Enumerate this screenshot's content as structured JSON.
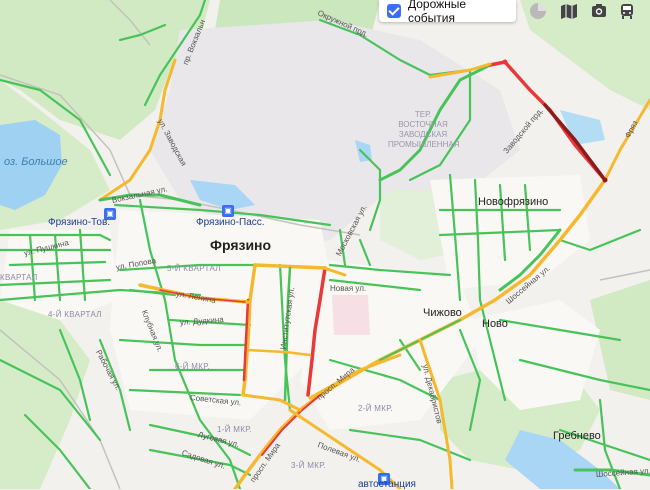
{
  "controls": {
    "traffic_events_label": "Дорожные события",
    "traffic_events_checked": true,
    "icons": [
      "traffic-level-icon",
      "map-layers-icon",
      "camera-icon",
      "transport-icon"
    ]
  },
  "map": {
    "city": "Фрязино",
    "places": {
      "novofryazino": "Новофрязино",
      "chizhovo": "Чижово",
      "novo": "Ново",
      "grebnevo": "Гребнево"
    },
    "lake": "оз. Большое",
    "stations": {
      "fryazino_tov": "Фрязино-Тов.",
      "fryazino_pass": "Фрязино-Пасс."
    },
    "bus_stop": "автостанция",
    "zone": [
      "ТЕР.",
      "ВОСТОЧНАЯ",
      "ЗАВОДСКАЯ",
      "ПРОМЫШЛЕННАЯ"
    ],
    "districts": {
      "q5": "5-Й КВАРТАЛ",
      "q4": "4-Й КВАРТАЛ",
      "kvartal": "КВАРТАЛ",
      "mkr6": "6-Й МКР.",
      "mkr1": "1-Й МКР.",
      "mkr2": "2-Й МКР.",
      "mkr3": "3-Й МКР."
    },
    "streets": {
      "okruzhnoy": "Окружной прд.",
      "vokzalnaya": "Вокзальная ул.",
      "pushkina": "ул. Пушкина",
      "popova": "ул. Попова",
      "lenina": "ул. Ленина",
      "dudkina": "ул. Дудкина",
      "klubnaya": "Клубная ул.",
      "rabochaya": "Рабочая ул.",
      "sovetskaya": "Советская ул.",
      "lugovaya": "Луговая ул.",
      "sadovaya": "Садовая ул.",
      "institutskaya": "Институтская ул.",
      "novaya": "Новая ул.",
      "moskovskaya": "Московская ул.",
      "mira_1": "просп. Мира",
      "mira_2": "просп. Мира",
      "polevaya": "Полевая ул.",
      "dekabristov": "ул. Декабристов",
      "shosseynaya_1": "Шоссейная ул.",
      "shosseynaya_2": "Шоссейная ул.",
      "zavodskoy": "Заводской прд.",
      "frya": "Фряз",
      "vokzalnaya_2": "пр. Вокзальн",
      "zavodskoy_2": "ул. Заводская"
    }
  }
}
